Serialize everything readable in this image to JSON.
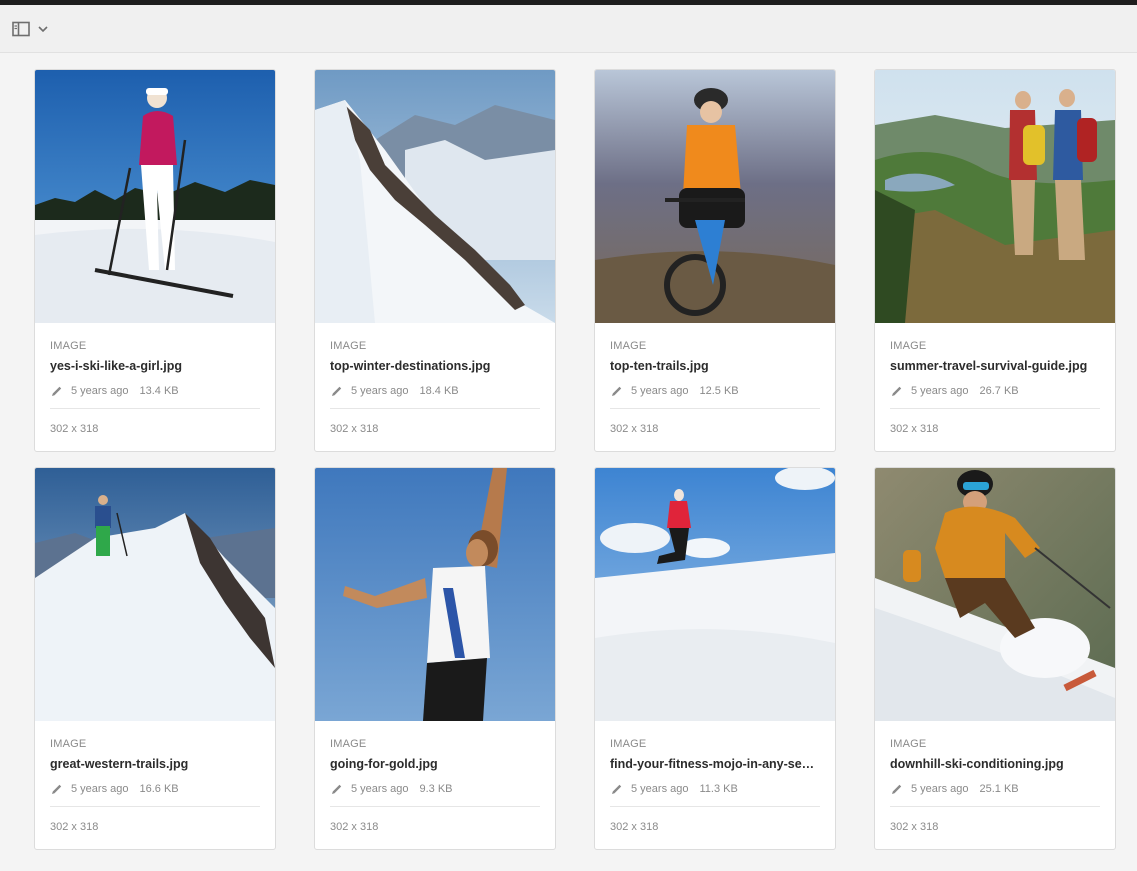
{
  "toolbar": {
    "rail_icon": "rail-toggle-icon",
    "chevron_icon": "chevron-down-icon"
  },
  "cards": [
    {
      "type": "IMAGE",
      "name": "yes-i-ski-like-a-girl.jpg",
      "modified": "5 years ago",
      "size": "13.4 KB",
      "dimensions": "302 x 318"
    },
    {
      "type": "IMAGE",
      "name": "top-winter-destinations.jpg",
      "modified": "5 years ago",
      "size": "18.4 KB",
      "dimensions": "302 x 318"
    },
    {
      "type": "IMAGE",
      "name": "top-ten-trails.jpg",
      "modified": "5 years ago",
      "size": "12.5 KB",
      "dimensions": "302 x 318"
    },
    {
      "type": "IMAGE",
      "name": "summer-travel-survival-guide.jpg",
      "modified": "5 years ago",
      "size": "26.7 KB",
      "dimensions": "302 x 318"
    },
    {
      "type": "IMAGE",
      "name": "great-western-trails.jpg",
      "modified": "5 years ago",
      "size": "16.6 KB",
      "dimensions": "302 x 318"
    },
    {
      "type": "IMAGE",
      "name": "going-for-gold.jpg",
      "modified": "5 years ago",
      "size": "9.3 KB",
      "dimensions": "302 x 318"
    },
    {
      "type": "IMAGE",
      "name": "find-your-fitness-mojo-in-any-seaso...",
      "modified": "5 years ago",
      "size": "11.3 KB",
      "dimensions": "302 x 318"
    },
    {
      "type": "IMAGE",
      "name": "downhill-ski-conditioning.jpg",
      "modified": "5 years ago",
      "size": "25.1 KB",
      "dimensions": "302 x 318"
    }
  ]
}
